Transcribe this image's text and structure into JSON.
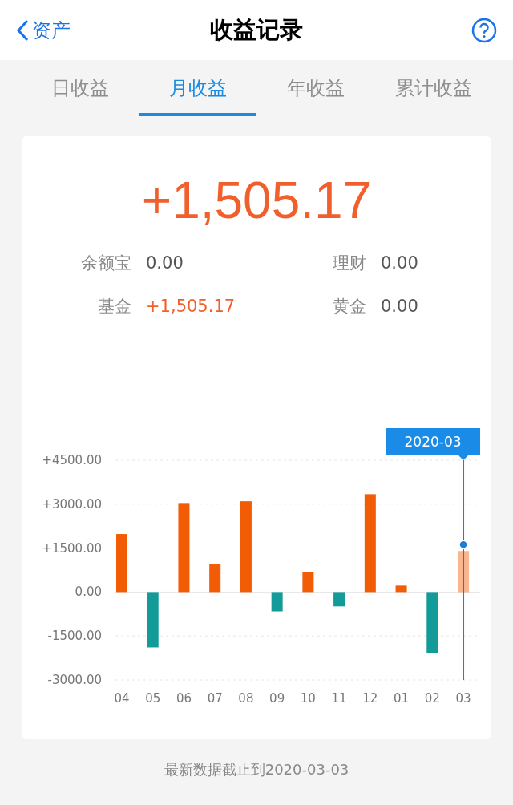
{
  "nav": {
    "back": "资产",
    "title": "收益记录"
  },
  "tabs": [
    {
      "label": "日收益",
      "selected": false
    },
    {
      "label": "月收益",
      "selected": true
    },
    {
      "label": "年收益",
      "selected": false
    },
    {
      "label": "累计收益",
      "selected": false
    }
  ],
  "summary": {
    "total": "+1,505.17",
    "items": [
      {
        "label": "余额宝",
        "value": "0.00",
        "positive": false
      },
      {
        "label": "理财",
        "value": "0.00",
        "positive": false
      },
      {
        "label": "基金",
        "value": "+1,505.17",
        "positive": true
      },
      {
        "label": "黄金",
        "value": "0.00",
        "positive": false
      }
    ]
  },
  "chart_data": {
    "type": "bar",
    "stacked": true,
    "grid": true,
    "categories": [
      "04",
      "05",
      "06",
      "07",
      "08",
      "09",
      "10",
      "11",
      "12",
      "01",
      "02",
      "03"
    ],
    "series": [
      {
        "color": "#f25c05",
        "values": [
          1980,
          null,
          3040,
          960,
          3100,
          null,
          690,
          null,
          3340,
          220,
          null,
          1400
        ]
      },
      {
        "color": "#129b98",
        "values": [
          null,
          -1890,
          null,
          null,
          null,
          -660,
          null,
          -490,
          null,
          null,
          -2080,
          null
        ]
      }
    ],
    "ylim": [
      -3000,
      4500
    ],
    "yticks": [
      {
        "value": 4500,
        "label": "+4500.00"
      },
      {
        "value": 3000,
        "label": "+3000.00"
      },
      {
        "value": 1500,
        "label": "+1500.00"
      },
      {
        "value": 0,
        "label": "0.00"
      },
      {
        "value": -1500,
        "label": "-1500.00"
      },
      {
        "value": -3000,
        "label": "-3000.00"
      }
    ],
    "ref_lines": [
      {
        "axis": "x",
        "value": "03",
        "color": "#1a7fd6"
      }
    ],
    "annotations": [
      "2020-03"
    ]
  },
  "footer": "最新数据截止到2020-03-03"
}
